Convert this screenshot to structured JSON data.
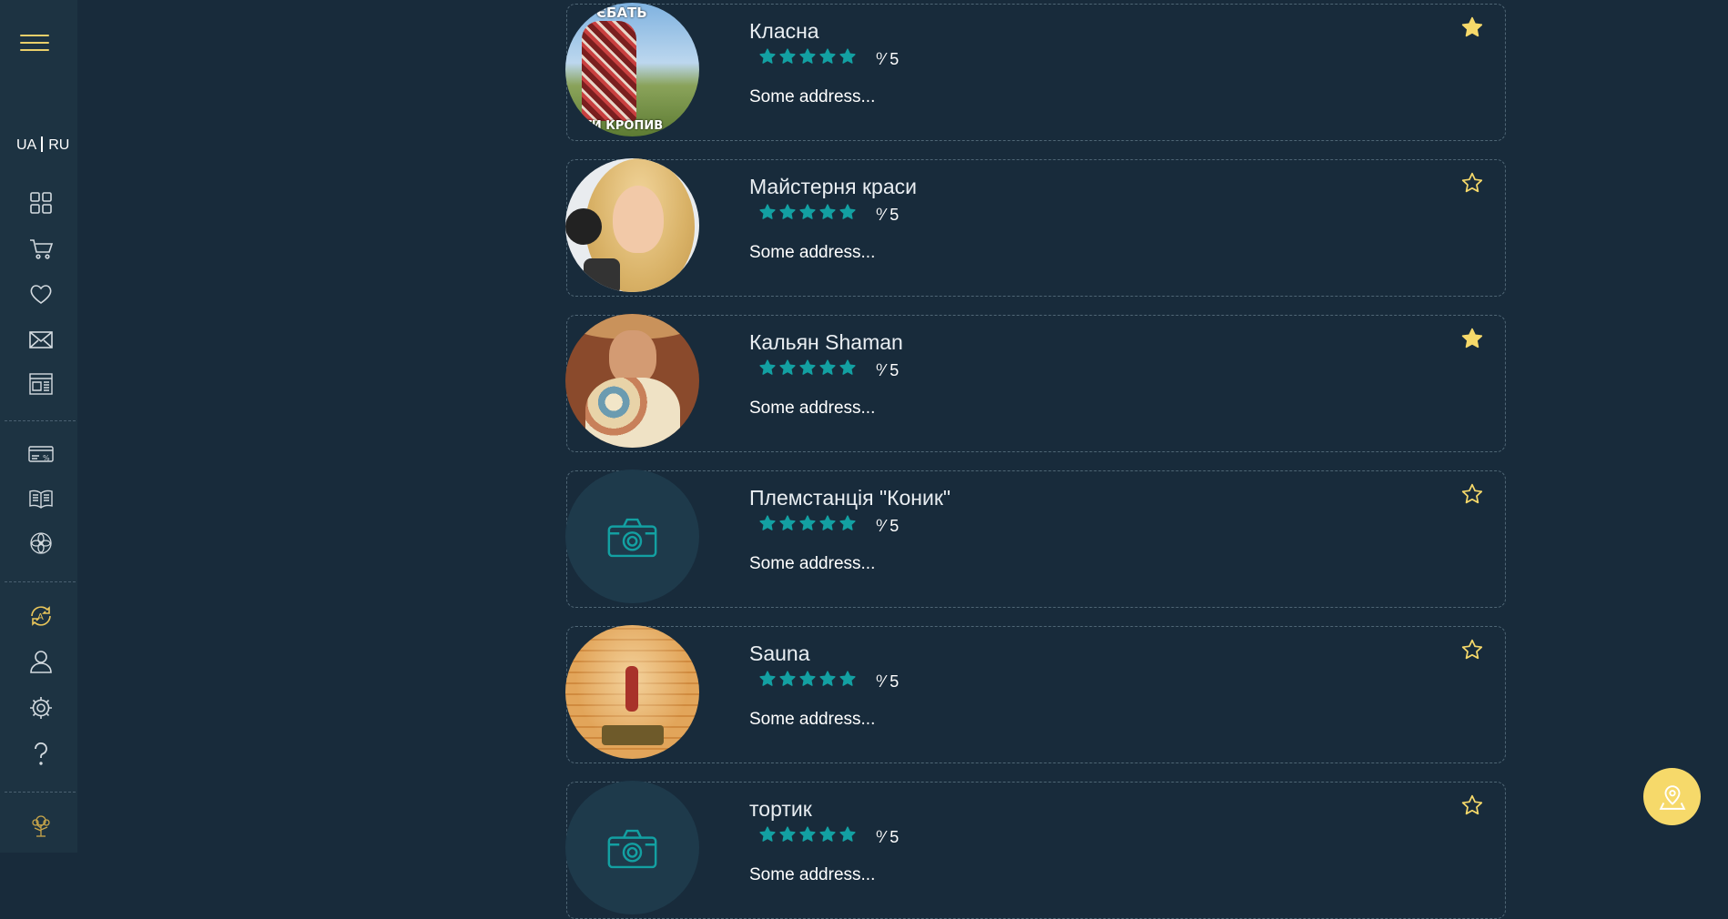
{
  "sidebar": {
    "lang_ua": "UA",
    "lang_ru": "RU",
    "icons": [
      "grid-icon",
      "cart-icon",
      "heart-icon",
      "mail-icon",
      "news-icon",
      "card-discount-icon",
      "book-icon",
      "flower-icon",
      "refresh-a-icon",
      "user-icon",
      "gear-icon",
      "help-icon",
      "tree-logo-icon"
    ]
  },
  "listings": [
    {
      "title": "Класна",
      "rating": "⁰⁄ 5",
      "stars": 5,
      "address": "Some address...",
      "favorite": true,
      "image": "photo-man-field"
    },
    {
      "title": "Майстерня краси",
      "rating": "⁰⁄ 5",
      "stars": 5,
      "address": "Some address...",
      "favorite": false,
      "image": "photo-woman-makeup"
    },
    {
      "title": "Кальян Shaman",
      "rating": "⁰⁄ 5",
      "stars": 5,
      "address": "Some address...",
      "favorite": true,
      "image": "photo-man-hat"
    },
    {
      "title": "Племстанція \"Коник\"",
      "rating": "⁰⁄ 5",
      "stars": 5,
      "address": "Some address...",
      "favorite": false,
      "image": "camera-placeholder"
    },
    {
      "title": "Sauna",
      "rating": "⁰⁄ 5",
      "stars": 5,
      "address": "Some address...",
      "favorite": false,
      "image": "photo-sauna"
    },
    {
      "title": "тортик",
      "rating": "⁰⁄ 5",
      "stars": 5,
      "address": "Some address...",
      "favorite": false,
      "image": "camera-placeholder"
    }
  ],
  "colors": {
    "background": "#182b3b",
    "sidebar": "#1d3342",
    "accent_gold": "#f6d96a",
    "star_teal": "#13a0a2"
  },
  "map_button_icon": "map-pin-icon"
}
